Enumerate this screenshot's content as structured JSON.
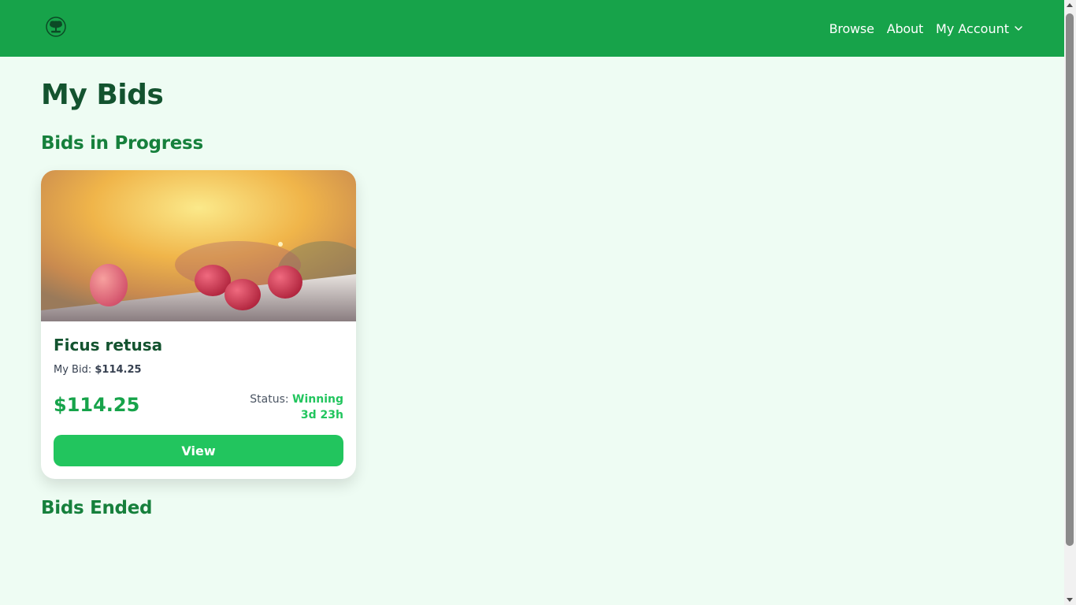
{
  "nav": {
    "logo_icon": "bonsai-tree-logo-icon",
    "links": [
      "Browse",
      "About"
    ],
    "account_label": "My Account",
    "account_icon": "chevron-down-icon"
  },
  "page": {
    "title": "My Bids",
    "section_in_progress": "Bids in Progress",
    "section_ended": "Bids Ended"
  },
  "bids_in_progress": [
    {
      "name": "Ficus retusa",
      "image": "raspberries-on-table-photo",
      "my_bid_label": "My Bid:",
      "my_bid_value": "$114.25",
      "price": "$114.25",
      "status_label": "Status:",
      "status_value": "Winning",
      "time_left": "3d 23h",
      "view_label": "View"
    }
  ],
  "colors": {
    "navbar": "#17a34a",
    "background": "#eefcf3",
    "accent": "#22c55e",
    "heading": "#13532f"
  }
}
